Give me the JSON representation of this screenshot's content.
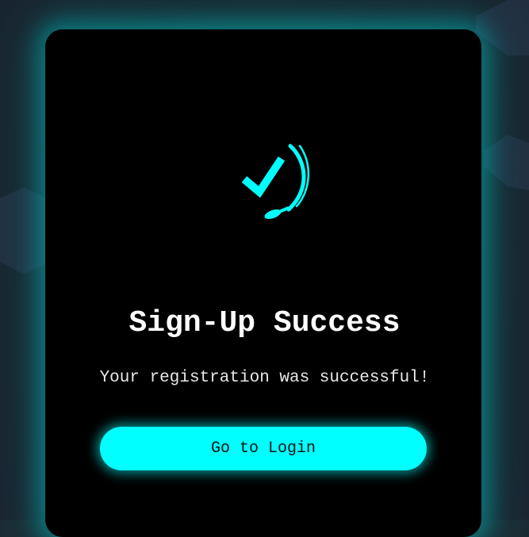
{
  "card": {
    "icon": "success-check-icon",
    "title": "Sign-Up Success",
    "message": "Your registration was successful!",
    "login_button_label": "Go to Login"
  },
  "colors": {
    "accent": "#00ffff",
    "card_background": "#000000",
    "page_background": "#1c2a33",
    "title_text": "#ffffff"
  }
}
